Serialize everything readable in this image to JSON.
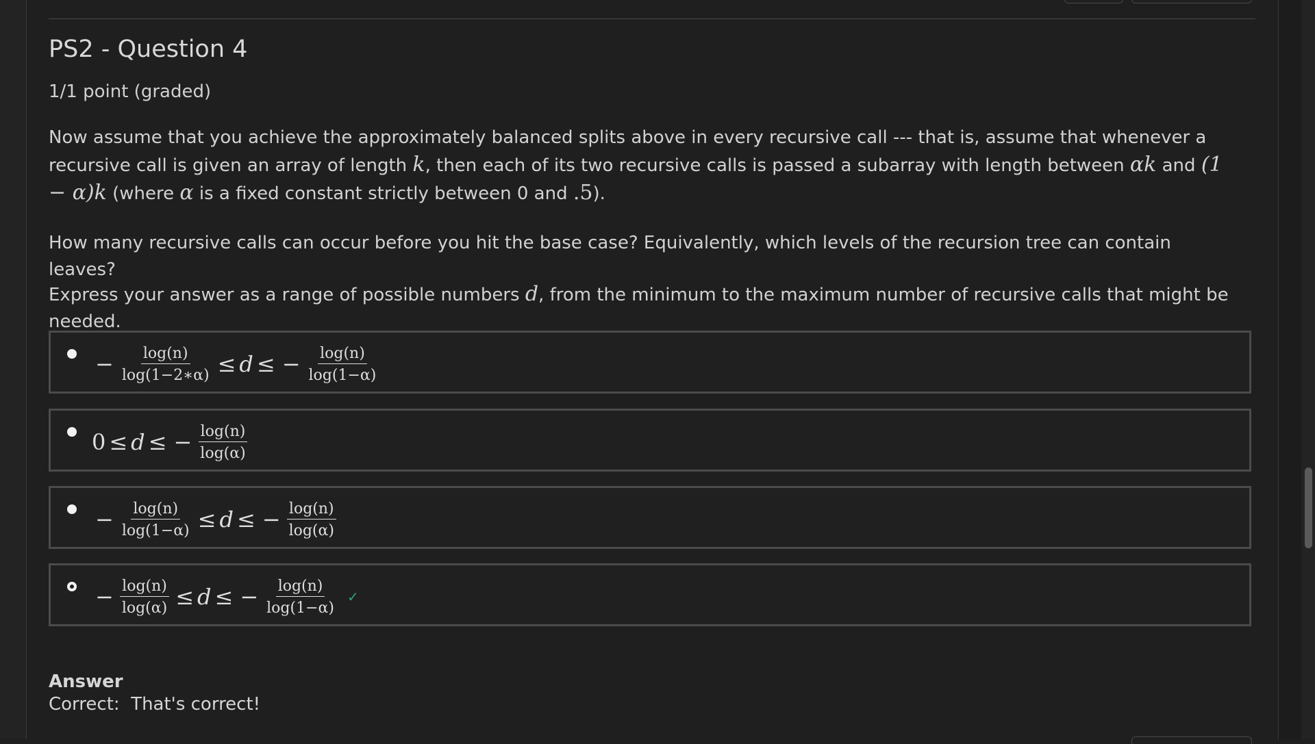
{
  "problem": {
    "title": "PS2 - Question 4",
    "points": "1/1 point (graded)",
    "para1": {
      "t1": "Now assume that you achieve the approximately balanced splits above in every recursive call --- that is, assume that whenever a recursive call is given an array of length ",
      "m1": "k",
      "t2": ", then each of its two recursive calls is passed a subarray with length between ",
      "m2": "αk",
      "t3": " and ",
      "m3": "(1 − α)k",
      "t4": " (where ",
      "m4": "α",
      "t5": " is a fixed constant strictly between 0 and ",
      "m5": ".5",
      "t6": ")."
    },
    "para2": "How many recursive calls can occur before you hit the base case? Equivalently, which levels of the recursion tree can contain leaves?",
    "para3": {
      "t1": "Express your answer as a range of possible numbers ",
      "m1": "d",
      "t2": ", from the minimum to the maximum number of recursive calls that might be needed."
    }
  },
  "options": [
    {
      "selected": false,
      "lo_num": "log(n)",
      "lo_den": "log(1−2∗α)",
      "hi_num": "log(n)",
      "hi_den": "log(1−α)"
    },
    {
      "selected": false,
      "lo_text": "0",
      "hi_num": "log(n)",
      "hi_den": "log(α)"
    },
    {
      "selected": false,
      "lo_num": "log(n)",
      "lo_den": "log(1−α)",
      "hi_num": "log(n)",
      "hi_den": "log(α)"
    },
    {
      "selected": true,
      "lo_num": "log(n)",
      "lo_den": "log(α)",
      "hi_num": "log(n)",
      "hi_den": "log(1−α)",
      "status_icon": "checkmark-icon"
    }
  ],
  "symbols": {
    "minus": "−",
    "leq": "≤",
    "var": "d"
  },
  "answer": {
    "heading": "Answer",
    "text": "Correct:  That's correct!"
  },
  "colors": {
    "background": "#1f1f1f",
    "text": "#d9d9d9",
    "border": "#4b4b4b",
    "correct": "#2fa37a"
  }
}
